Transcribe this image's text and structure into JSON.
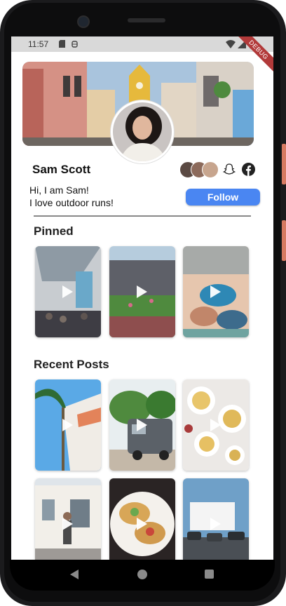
{
  "status_bar": {
    "time": "11:57",
    "debug_banner": "DEBUG"
  },
  "profile": {
    "name": "Sam Scott",
    "bio_line1": "Hi, I am Sam!",
    "bio_line2": "I love outdoor runs!",
    "follow_label": "Follow"
  },
  "sections": {
    "pinned_title": "Pinned",
    "recent_title": "Recent Posts"
  },
  "pinned": [
    {
      "scene": "expo-hall"
    },
    {
      "scene": "stadium"
    },
    {
      "scene": "yoga-class"
    }
  ],
  "recent_posts": [
    {
      "scene": "palm-building"
    },
    {
      "scene": "camper-van"
    },
    {
      "scene": "pasta-dinner"
    },
    {
      "scene": "street-walker"
    },
    {
      "scene": "tacos"
    },
    {
      "scene": "drive-in"
    }
  ],
  "social_icons": [
    "friend-avatars",
    "snapchat-icon",
    "facebook-icon"
  ],
  "colors": {
    "accent": "#4a86f2",
    "debug": "#b23a3a"
  }
}
